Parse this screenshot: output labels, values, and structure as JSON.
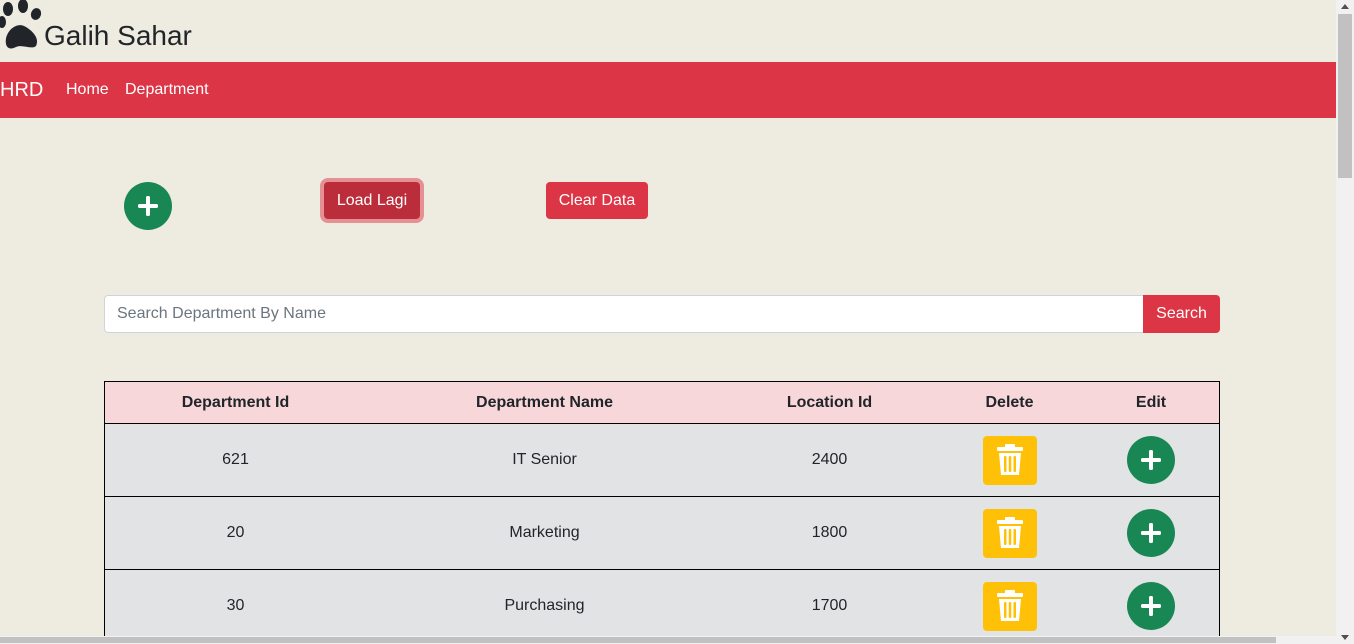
{
  "header": {
    "title": "Galih Sahar",
    "logo_icon": "paw-icon"
  },
  "navbar": {
    "brand": "HRD",
    "links": [
      "Home",
      "Department"
    ],
    "color": "#dc3545"
  },
  "actions": {
    "add_icon": "plus-circle-icon",
    "load_label": "Load Lagi",
    "clear_label": "Clear Data"
  },
  "search": {
    "placeholder": "Search Department By Name",
    "value": "",
    "button_label": "Search"
  },
  "table": {
    "headers": [
      "Department Id",
      "Department Name",
      "Location Id",
      "Delete",
      "Edit"
    ],
    "rows": [
      {
        "id": "621",
        "name": "IT Senior",
        "location": "2400"
      },
      {
        "id": "20",
        "name": "Marketing",
        "location": "1800"
      },
      {
        "id": "30",
        "name": "Purchasing",
        "location": "1700"
      }
    ],
    "delete_icon": "trash-icon",
    "edit_icon": "plus-circle-icon"
  },
  "colors": {
    "background": "#eeece0",
    "danger": "#dc3545",
    "success": "#198754",
    "warning": "#ffc107",
    "header_row": "#f8d7da",
    "body_row": "#e2e3e5"
  }
}
